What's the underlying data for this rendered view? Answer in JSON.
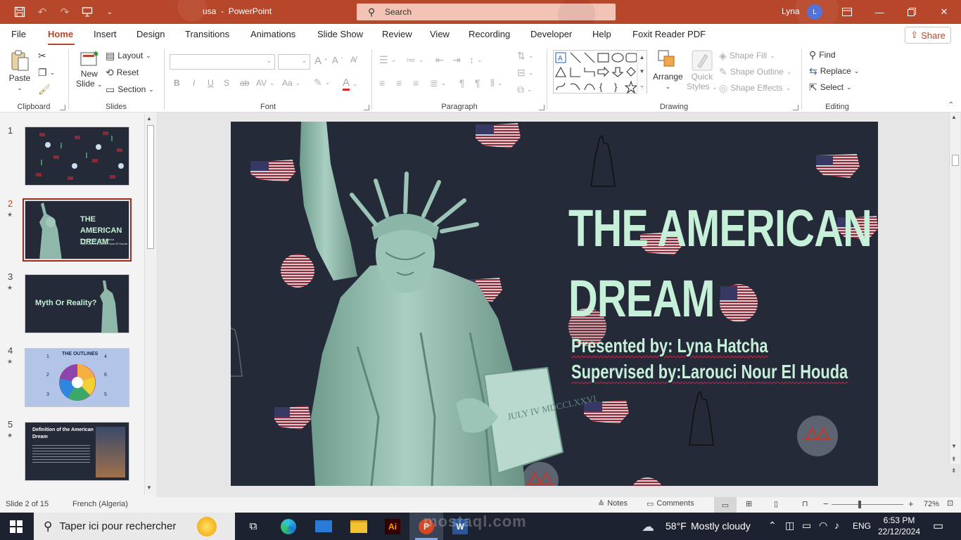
{
  "window": {
    "doc_name": "usa",
    "app_name": "PowerPoint",
    "separator": "-",
    "user": "Lyna",
    "user_initial": "L"
  },
  "search": {
    "placeholder": "Search"
  },
  "menu": {
    "tabs": [
      "File",
      "Home",
      "Insert",
      "Design",
      "Transitions",
      "Animations",
      "Slide Show",
      "Review",
      "View",
      "Recording",
      "Developer",
      "Help",
      "Foxit Reader PDF"
    ],
    "active": "Home",
    "share": "Share"
  },
  "ribbon": {
    "clipboard": {
      "label": "Clipboard",
      "paste": "Paste"
    },
    "slides": {
      "label": "Slides",
      "new_slide": "New",
      "new_slide_2": "Slide",
      "layout": "Layout",
      "reset": "Reset",
      "section": "Section"
    },
    "font": {
      "label": "Font",
      "bold": "B",
      "italic": "I",
      "underline": "U",
      "shadow": "S",
      "strike": "ab",
      "spacing": "AV",
      "case": "Aa"
    },
    "paragraph": {
      "label": "Paragraph"
    },
    "drawing": {
      "label": "Drawing",
      "arrange": "Arrange",
      "quick_styles": "Quick",
      "quick_styles_2": "Styles",
      "shape_fill": "Shape Fill",
      "shape_outline": "Shape Outline",
      "shape_effects": "Shape Effects"
    },
    "editing": {
      "label": "Editing",
      "find": "Find",
      "replace": "Replace",
      "select": "Select"
    }
  },
  "thumbnails": [
    {
      "num": "1",
      "star": ""
    },
    {
      "num": "2",
      "star": "★",
      "title": "THE AMERICAN DREAM",
      "sub1": "Presented by: Lyna Hatcha",
      "sub2": "Supervised by:Larouci Nour El Houda"
    },
    {
      "num": "3",
      "star": "★",
      "title": "Myth Or Reality?"
    },
    {
      "num": "4",
      "star": "★",
      "title": "THE OUTLINES",
      "n1": "1",
      "n2": "2",
      "n3": "3",
      "n4": "4",
      "n5": "5",
      "n6": "6"
    },
    {
      "num": "5",
      "star": "★",
      "title": "Definition of the American Dream"
    }
  ],
  "slide": {
    "title_line1": "THE AMERICAN",
    "title_line2": "DREAM",
    "presented": "Presented by: Lyna Hatcha",
    "supervised": "Supervised by:Larouci Nour El Houda",
    "book_text": "JULY IV MDCCLXXVI"
  },
  "status": {
    "slide_info": "Slide 2 of 15",
    "language": "French (Algeria)",
    "notes": "Notes",
    "comments": "Comments",
    "zoom": "72%",
    "minus": "−",
    "plus": "+"
  },
  "taskbar": {
    "search_placeholder": "Taper ici pour rechercher",
    "temp": "58°F",
    "weather": "Mostly cloudy",
    "lang": "ENG",
    "time": "6:53 PM",
    "date": "22/12/2024"
  },
  "watermark": {
    "text": "mostaql.com"
  },
  "colors": {
    "accent": "#b7472a",
    "slide_bg": "#242a38",
    "title_color": "#c6f0d8",
    "statue": "#8fb8aa"
  }
}
